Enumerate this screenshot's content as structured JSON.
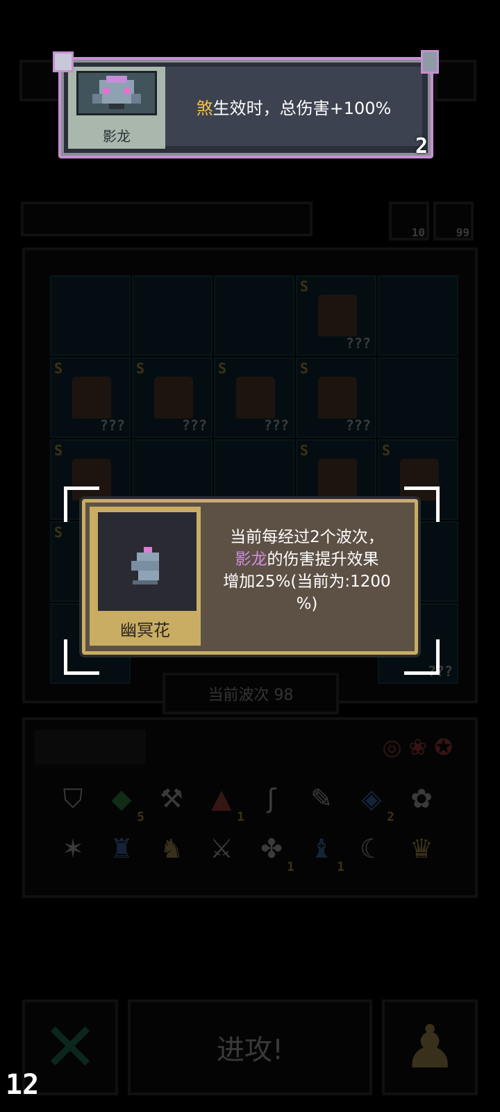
{
  "top_popup": {
    "pet_name": "影龙",
    "desc_highlight": "煞",
    "desc_rest": "生效时，总伤害+100%",
    "count": "2"
  },
  "board": {
    "corner_counts": [
      "10",
      "99"
    ],
    "wave_label": "当前波次 98",
    "question_marks": "???"
  },
  "item_popup": {
    "item_name": "幽冥花",
    "line1": "当前每经过2个波次，",
    "line2_highlight": "影龙",
    "line2_rest": "的伤害提升效果",
    "line3": "增加25%(当前为:1200",
    "line4": "%)"
  },
  "inventory": {
    "counts": [
      "5",
      "1",
      "2",
      "1",
      "1"
    ]
  },
  "bottom": {
    "attack_label": "进攻!",
    "corner_number": "12"
  },
  "colors": {
    "top_border": "#c78fd1",
    "highlight_gold": "#f0c24a",
    "highlight_purple": "#cf8ee0",
    "item_frame": "#c9ad63"
  }
}
